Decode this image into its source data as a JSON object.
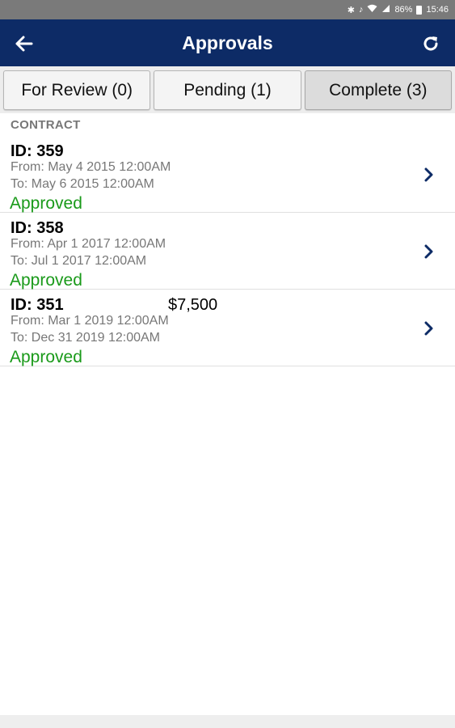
{
  "status_bar": {
    "battery": "86%",
    "time": "15:46",
    "icons": [
      "bluetooth-icon",
      "mute-icon",
      "wifi-icon",
      "signal-icon",
      "battery-icon"
    ]
  },
  "app_bar": {
    "title": "Approvals",
    "background": "#0d2b66",
    "icons": [
      "back-arrow-icon",
      "refresh-icon"
    ]
  },
  "tabs": [
    {
      "label": "For Review (0)",
      "active": false
    },
    {
      "label": "Pending (1)",
      "active": false
    },
    {
      "label": "Complete (3)",
      "active": true
    }
  ],
  "section_header": "CONTRACT",
  "contracts": [
    {
      "id": "ID: 359",
      "amount": "",
      "from": "From: May  4 2015 12:00AM",
      "to": "To: May  6 2015 12:00AM",
      "status": "Approved"
    },
    {
      "id": "ID: 358",
      "amount": "",
      "from": "From: Apr  1 2017 12:00AM",
      "to": "To: Jul  1 2017 12:00AM",
      "status": "Approved"
    },
    {
      "id": "ID: 351",
      "amount": "$7,500",
      "from": "From: Mar  1 2019 12:00AM",
      "to": "To: Dec 31 2019 12:00AM",
      "status": "Approved"
    }
  ],
  "colors": {
    "approved": "#1a9a1a",
    "chevron": "#0d2b66"
  }
}
